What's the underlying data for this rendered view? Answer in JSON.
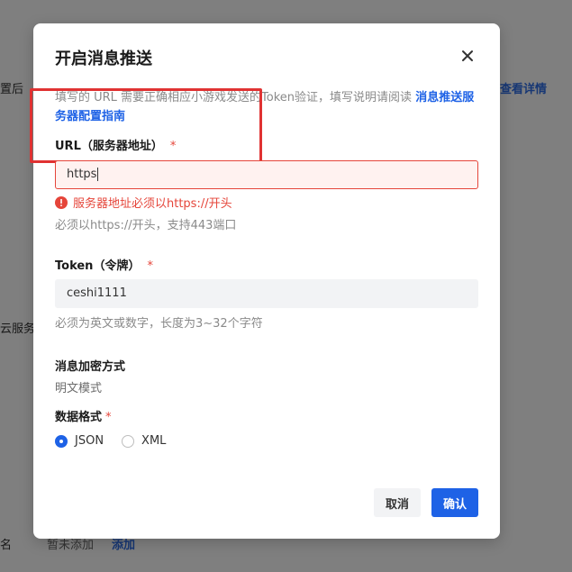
{
  "background": {
    "left_text_1": "置后",
    "left_text_2": "云服务",
    "left_text_3": "名",
    "right_link": "查看详情",
    "bottom_text": "暂未添加",
    "bottom_link": "添加"
  },
  "modal": {
    "title": "开启消息推送",
    "close_icon": "close-icon",
    "description_prefix": "填写的 URL 需要正确相应小游戏发送的Token验证，填写说明请阅读",
    "description_link": "消息推送服务器配置指南",
    "url_field": {
      "label": "URL（服务器地址）",
      "required_mark": "*",
      "value": "https",
      "error": "服务器地址必须以https://开头",
      "hint": "必须以https://开头，支持443端口"
    },
    "token_field": {
      "label": "Token（令牌）",
      "required_mark": "*",
      "value": "ceshi1111",
      "hint": "必须为英文或数字，长度为3~32个字符"
    },
    "encryption": {
      "label": "消息加密方式",
      "value": "明文模式"
    },
    "data_format": {
      "label": "数据格式",
      "required_mark": "*",
      "options": [
        "JSON",
        "XML"
      ],
      "selected": "JSON"
    },
    "buttons": {
      "cancel": "取消",
      "confirm": "确认"
    }
  },
  "colors": {
    "primary": "#1e62e6",
    "error": "#e5453a",
    "annotation": "#e03232"
  }
}
